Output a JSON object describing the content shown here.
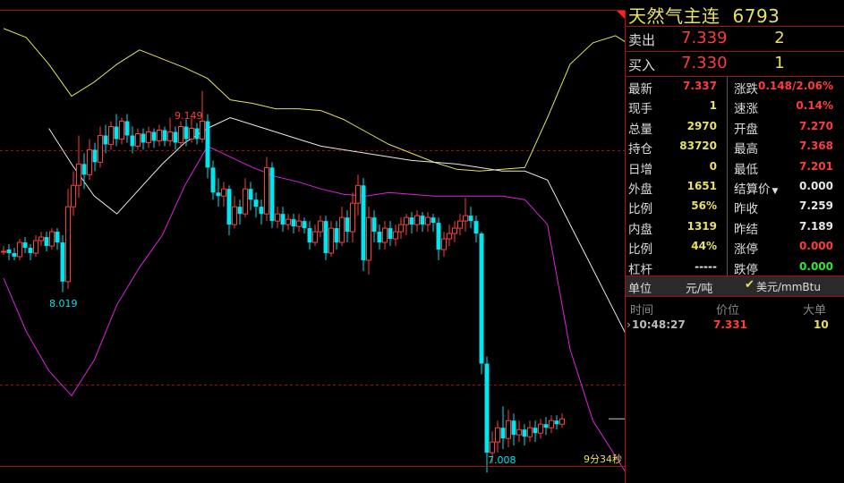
{
  "chart_data": {
    "type": "candlestick",
    "ylim": [
      6.95,
      9.6
    ],
    "reference_lines": [
      8.815,
      7.5
    ],
    "marker_labels": {
      "high": "9.149",
      "low": "8.019",
      "bottom": "7.008"
    },
    "countdown": "9分34秒",
    "candles": [
      [
        8.25,
        8.25,
        8.23,
        8.28
      ],
      [
        8.26,
        8.24,
        8.2,
        8.29
      ],
      [
        8.24,
        8.22,
        8.2,
        8.27
      ],
      [
        8.22,
        8.3,
        8.2,
        8.32
      ],
      [
        8.3,
        8.27,
        8.24,
        8.33
      ],
      [
        8.27,
        8.24,
        8.2,
        8.29
      ],
      [
        8.24,
        8.31,
        8.22,
        8.34
      ],
      [
        8.31,
        8.33,
        8.28,
        8.36
      ],
      [
        8.33,
        8.28,
        8.25,
        8.36
      ],
      [
        8.28,
        8.36,
        8.26,
        8.38
      ],
      [
        8.36,
        8.3,
        8.26,
        8.38
      ],
      [
        8.3,
        8.08,
        8.02,
        8.34
      ],
      [
        8.08,
        8.5,
        8.04,
        8.6
      ],
      [
        8.5,
        8.62,
        8.45,
        8.7
      ],
      [
        8.62,
        8.74,
        8.55,
        8.9
      ],
      [
        8.74,
        8.68,
        8.6,
        8.8
      ],
      [
        8.68,
        8.82,
        8.65,
        8.88
      ],
      [
        8.82,
        8.75,
        8.7,
        8.86
      ],
      [
        8.75,
        8.9,
        8.72,
        8.95
      ],
      [
        8.9,
        8.85,
        8.8,
        8.96
      ],
      [
        8.85,
        8.95,
        8.82,
        8.98
      ],
      [
        8.95,
        8.88,
        8.84,
        9.02
      ],
      [
        8.88,
        8.98,
        8.85,
        9.0
      ],
      [
        8.98,
        8.9,
        8.86,
        9.02
      ],
      [
        8.9,
        8.84,
        8.8,
        8.95
      ],
      [
        8.84,
        8.91,
        8.82,
        8.94
      ],
      [
        8.91,
        8.86,
        8.82,
        8.94
      ],
      [
        8.86,
        8.92,
        8.83,
        8.95
      ],
      [
        8.92,
        8.87,
        8.83,
        8.94
      ],
      [
        8.87,
        8.93,
        8.84,
        8.96
      ],
      [
        8.93,
        8.87,
        8.84,
        8.95
      ],
      [
        8.87,
        8.92,
        8.84,
        9.0
      ],
      [
        8.92,
        8.86,
        8.82,
        8.95
      ],
      [
        8.86,
        8.95,
        8.84,
        8.98
      ],
      [
        8.95,
        8.88,
        8.84,
        8.99
      ],
      [
        8.88,
        8.94,
        8.86,
        9.0
      ],
      [
        8.94,
        8.88,
        8.85,
        8.97
      ],
      [
        8.88,
        8.98,
        8.86,
        9.149
      ],
      [
        8.98,
        8.72,
        8.66,
        9.02
      ],
      [
        8.72,
        8.58,
        8.54,
        8.76
      ],
      [
        8.58,
        8.56,
        8.5,
        8.66
      ],
      [
        8.56,
        8.6,
        8.5,
        8.64
      ],
      [
        8.6,
        8.4,
        8.34,
        8.62
      ],
      [
        8.4,
        8.5,
        8.38,
        8.56
      ],
      [
        8.5,
        8.46,
        8.4,
        8.54
      ],
      [
        8.46,
        8.6,
        8.44,
        8.66
      ],
      [
        8.6,
        8.54,
        8.48,
        8.64
      ],
      [
        8.54,
        8.5,
        8.44,
        8.58
      ],
      [
        8.5,
        8.46,
        8.4,
        8.54
      ],
      [
        8.46,
        8.72,
        8.42,
        8.78
      ],
      [
        8.72,
        8.42,
        8.38,
        8.75
      ],
      [
        8.42,
        8.46,
        8.38,
        8.5
      ],
      [
        8.46,
        8.4,
        8.36,
        8.5
      ],
      [
        8.4,
        8.43,
        8.37,
        8.46
      ],
      [
        8.43,
        8.39,
        8.35,
        8.46
      ],
      [
        8.39,
        8.42,
        8.36,
        8.46
      ],
      [
        8.42,
        8.38,
        8.35,
        8.44
      ],
      [
        8.38,
        8.3,
        8.26,
        8.42
      ],
      [
        8.3,
        8.36,
        8.28,
        8.4
      ],
      [
        8.36,
        8.42,
        8.33,
        8.45
      ],
      [
        8.42,
        8.24,
        8.2,
        8.45
      ],
      [
        8.24,
        8.38,
        8.22,
        8.42
      ],
      [
        8.38,
        8.3,
        8.26,
        8.42
      ],
      [
        8.3,
        8.44,
        8.28,
        8.5
      ],
      [
        8.44,
        8.36,
        8.3,
        8.48
      ],
      [
        8.36,
        8.52,
        8.3,
        8.58
      ],
      [
        8.52,
        8.62,
        8.45,
        8.68
      ],
      [
        8.62,
        8.2,
        8.14,
        8.66
      ],
      [
        8.2,
        8.44,
        8.12,
        8.5
      ],
      [
        8.44,
        8.36,
        8.3,
        8.48
      ],
      [
        8.36,
        8.3,
        8.26,
        8.4
      ],
      [
        8.3,
        8.38,
        8.26,
        8.42
      ],
      [
        8.38,
        8.32,
        8.28,
        8.42
      ],
      [
        8.32,
        8.36,
        8.28,
        8.4
      ],
      [
        8.36,
        8.4,
        8.32,
        8.44
      ],
      [
        8.4,
        8.44,
        8.34,
        8.46
      ],
      [
        8.44,
        8.4,
        8.35,
        8.47
      ],
      [
        8.4,
        8.45,
        8.36,
        8.48
      ],
      [
        8.45,
        8.4,
        8.36,
        8.47
      ],
      [
        8.4,
        8.44,
        8.36,
        8.47
      ],
      [
        8.44,
        8.41,
        8.36,
        8.46
      ],
      [
        8.41,
        8.26,
        8.2,
        8.44
      ],
      [
        8.26,
        8.32,
        8.22,
        8.36
      ],
      [
        8.32,
        8.35,
        8.28,
        8.4
      ],
      [
        8.35,
        8.38,
        8.3,
        8.42
      ],
      [
        8.38,
        8.42,
        8.34,
        8.46
      ],
      [
        8.42,
        8.45,
        8.36,
        8.55
      ],
      [
        8.45,
        8.42,
        8.38,
        8.5
      ],
      [
        8.42,
        8.35,
        8.3,
        8.45
      ],
      [
        8.35,
        7.62,
        7.56,
        8.36
      ],
      [
        7.62,
        7.12,
        7.008,
        7.66
      ],
      [
        7.12,
        7.18,
        7.06,
        7.24
      ],
      [
        7.18,
        7.26,
        7.12,
        7.3
      ],
      [
        7.26,
        7.2,
        7.14,
        7.38
      ],
      [
        7.2,
        7.3,
        7.15,
        7.36
      ],
      [
        7.3,
        7.22,
        7.16,
        7.34
      ],
      [
        7.22,
        7.25,
        7.18,
        7.3
      ],
      [
        7.25,
        7.21,
        7.16,
        7.28
      ],
      [
        7.21,
        7.26,
        7.18,
        7.3
      ],
      [
        7.26,
        7.23,
        7.18,
        7.3
      ],
      [
        7.23,
        7.28,
        7.2,
        7.31
      ],
      [
        7.28,
        7.26,
        7.22,
        7.32
      ],
      [
        7.26,
        7.3,
        7.23,
        7.33
      ],
      [
        7.3,
        7.28,
        7.25,
        7.33
      ],
      [
        7.28,
        7.31,
        7.26,
        7.34
      ]
    ],
    "bands": {
      "upper": [
        9.5,
        9.45,
        9.3,
        9.12,
        9.2,
        9.3,
        9.38,
        9.33,
        9.28,
        9.22,
        9.1,
        9.08,
        9.05,
        9.05,
        9.04,
        8.99,
        8.92,
        8.85,
        8.8,
        8.75,
        8.71,
        8.7,
        8.71,
        8.72,
        9.0,
        9.3,
        9.42,
        9.46,
        9.38
      ],
      "middle": [
        null,
        null,
        8.94,
        8.74,
        8.56,
        8.46,
        8.6,
        8.74,
        8.86,
        8.94,
        9.0,
        8.96,
        8.92,
        8.88,
        8.84,
        8.82,
        8.8,
        8.78,
        8.76,
        8.75,
        8.74,
        8.72,
        8.7,
        8.7,
        8.65,
        8.4,
        8.15,
        7.9,
        7.65
      ],
      "lower": [
        8.1,
        7.8,
        7.58,
        7.44,
        7.64,
        7.95,
        8.16,
        8.34,
        8.62,
        8.84,
        8.78,
        8.72,
        8.67,
        8.64,
        8.6,
        8.57,
        8.56,
        8.58,
        8.57,
        8.56,
        8.56,
        8.56,
        8.56,
        8.54,
        8.4,
        7.7,
        7.3,
        7.1,
        6.9
      ]
    }
  },
  "quote": {
    "name": "天然气主连",
    "code": "6793",
    "sell_label": "卖出",
    "sell_price": "7.339",
    "sell_vol": "2",
    "buy_label": "买入",
    "buy_price": "7.330",
    "buy_vol": "1",
    "stats": [
      {
        "l1": "最新",
        "v1": "7.337",
        "c1": "red",
        "l2": "涨跌",
        "v2": "0.148/2.06%",
        "c2": "red"
      },
      {
        "l1": "现手",
        "v1": "1",
        "c1": "yel",
        "l2": "速涨",
        "v2": "0.14%",
        "c2": "red"
      },
      {
        "l1": "总量",
        "v1": "2970",
        "c1": "yel",
        "l2": "开盘",
        "v2": "7.270",
        "c2": "red"
      },
      {
        "l1": "持仓",
        "v1": "83720",
        "c1": "yel",
        "l2": "最高",
        "v2": "7.368",
        "c2": "red"
      },
      {
        "l1": "日增",
        "v1": "0",
        "c1": "yel",
        "l2": "最低",
        "v2": "7.201",
        "c2": "red"
      },
      {
        "l1": "外盘",
        "v1": "1651",
        "c1": "yel",
        "l2": "结算价",
        "v2": "0.000",
        "c2": "wht"
      },
      {
        "l1": "比例",
        "v1": "56%",
        "c1": "yel",
        "l2": "昨收",
        "v2": "7.259",
        "c2": "wht"
      },
      {
        "l1": "内盘",
        "v1": "1319",
        "c1": "yel",
        "l2": "昨结",
        "v2": "7.189",
        "c2": "wht"
      },
      {
        "l1": "比例",
        "v1": "44%",
        "c1": "yel",
        "l2": "涨停",
        "v2": "0.000",
        "c2": "red"
      },
      {
        "l1": "杠杆",
        "v1": "-----",
        "c1": "wht",
        "l2": "跌停",
        "v2": "0.000",
        "c2": "grn"
      }
    ],
    "unit_label": "单位",
    "unit_value": "元/吨",
    "unit_alt": "美元/mmBtu",
    "tick_headers": {
      "time": "时间",
      "price": "价位",
      "big": "大单"
    },
    "ticks": [
      {
        "time": "10:48:27",
        "price": "7.331",
        "vol": "10"
      }
    ]
  },
  "colors": {
    "up": "#ff3b3b",
    "down": "#00e5ee",
    "upper_band": "#e0e060",
    "middle_band": "#e8e8e8",
    "lower_band": "#e020e0",
    "frame": "#b01010"
  }
}
